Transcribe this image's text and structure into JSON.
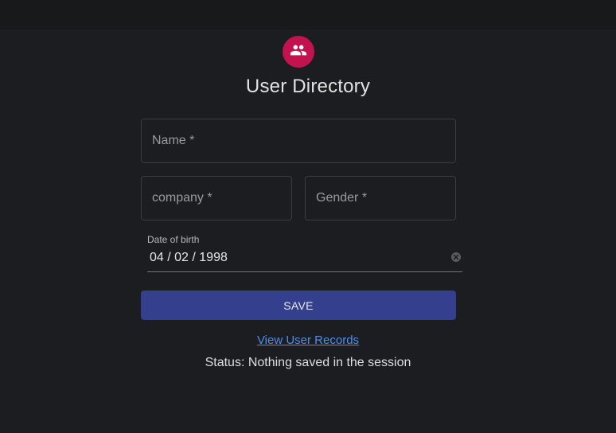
{
  "header": {
    "icon": "people-icon",
    "title": "User Directory",
    "accent_color": "#c2134f"
  },
  "form": {
    "name_placeholder": "Name *",
    "company_placeholder": "company *",
    "gender_placeholder": "Gender *",
    "dob_label": "Date of birth",
    "dob_value": "04 / 02 / 1998",
    "save_label": "SAVE",
    "save_color": "#343f8e"
  },
  "links": {
    "view_records": "View User Records"
  },
  "status": {
    "text": "Status: Nothing saved in the session"
  }
}
